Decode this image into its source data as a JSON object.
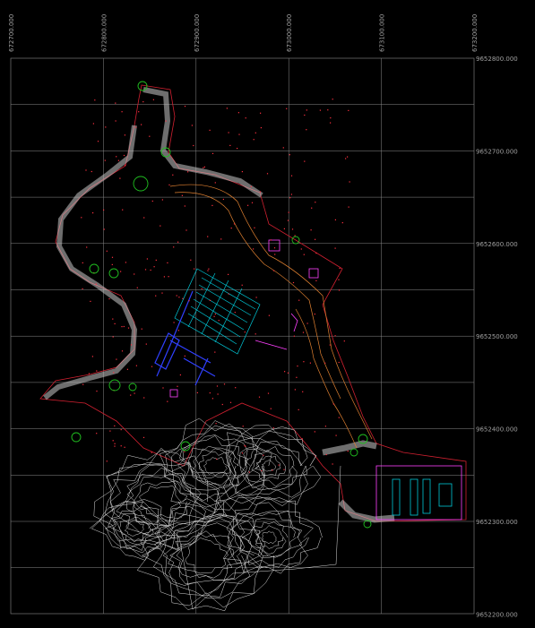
{
  "drawing": {
    "background": "#000000",
    "grid_color": "#8a8a8a",
    "x_axis_labels": [
      "672700.000",
      "672800.000",
      "672900.000",
      "673000.000",
      "673100.000",
      "673200.000"
    ],
    "y_axis_labels": [
      "9652800.000",
      "9652700.000",
      "9652600.000",
      "9652500.000",
      "9652400.000",
      "9652300.000",
      "9652200.000"
    ],
    "layer_colors": {
      "boundary": "#d02030",
      "road": "#c8c8c8",
      "contour": "#e0e0e0",
      "building": "#00c8d8",
      "wall": "#3040ff",
      "vegetation": "#20c020",
      "annotation": "#ff40ff",
      "orange_line": "#e08030",
      "points": "#ff3040"
    },
    "icons": [
      "tree-icon"
    ]
  }
}
